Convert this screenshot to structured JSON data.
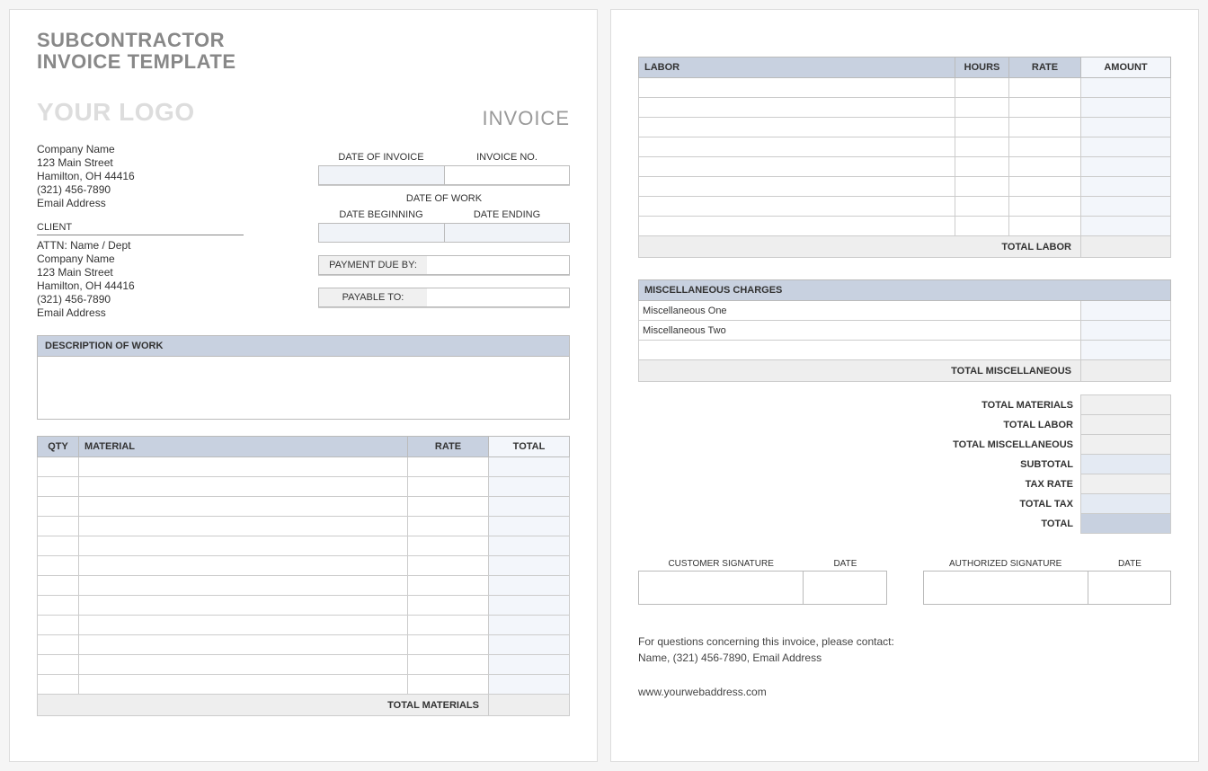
{
  "title_line1": "SUBCONTRACTOR",
  "title_line2": "INVOICE TEMPLATE",
  "logo": "YOUR LOGO",
  "invoice_word": "INVOICE",
  "company": {
    "name": "Company Name",
    "street": "123 Main Street",
    "city": "Hamilton, OH  44416",
    "phone": "(321) 456-7890",
    "email": "Email Address"
  },
  "client_header": "CLIENT",
  "client": {
    "attn": "ATTN: Name / Dept",
    "name": "Company Name",
    "street": "123 Main Street",
    "city": "Hamilton, OH  44416",
    "phone": "(321) 456-7890",
    "email": "Email Address"
  },
  "labels": {
    "date_invoice": "DATE OF INVOICE",
    "invoice_no": "INVOICE NO.",
    "date_of_work": "DATE OF WORK",
    "date_begin": "DATE BEGINNING",
    "date_end": "DATE ENDING",
    "payment_due": "PAYMENT DUE BY:",
    "payable_to": "PAYABLE TO:",
    "desc_work": "DESCRIPTION OF WORK",
    "qty": "QTY",
    "material": "MATERIAL",
    "rate": "RATE",
    "total": "TOTAL",
    "total_materials": "TOTAL MATERIALS",
    "labor": "LABOR",
    "hours": "HOURS",
    "amount": "AMOUNT",
    "total_labor": "TOTAL LABOR",
    "misc": "MISCELLANEOUS CHARGES",
    "total_misc": "TOTAL MISCELLANEOUS",
    "t_materials": "TOTAL MATERIALS",
    "t_labor": "TOTAL LABOR",
    "t_misc": "TOTAL MISCELLANEOUS",
    "subtotal": "SUBTOTAL",
    "tax_rate": "TAX RATE",
    "total_tax": "TOTAL TAX",
    "grand": "TOTAL",
    "cust_sig": "CUSTOMER SIGNATURE",
    "auth_sig": "AUTHORIZED SIGNATURE",
    "date": "DATE"
  },
  "misc_items": {
    "one": "Miscellaneous One",
    "two": "Miscellaneous Two"
  },
  "footer": {
    "q": "For questions concerning this invoice, please contact:",
    "contact": "Name, (321) 456-7890, Email Address",
    "web": "www.yourwebaddress.com"
  }
}
